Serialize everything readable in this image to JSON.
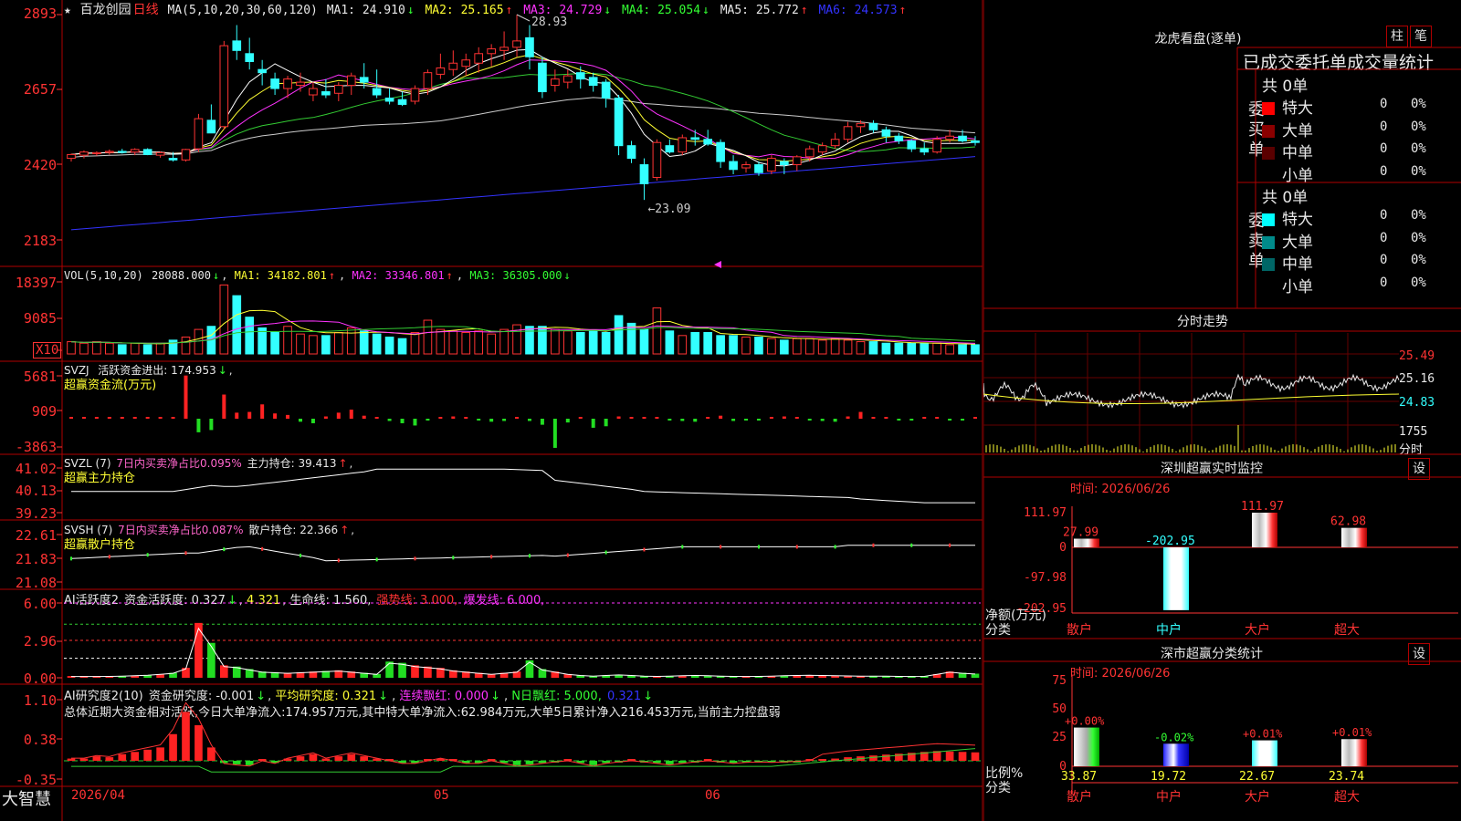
{
  "stock": {
    "star": "★",
    "name": "百龙创园",
    "period": "日线"
  },
  "ma": {
    "title": "MA(5,10,20,30,60,120)",
    "items": [
      {
        "label": "MA1: 24.910",
        "arrow": "↓",
        "color": "#e8e8e8"
      },
      {
        "label": "MA2: 25.165",
        "arrow": "↑",
        "color": "#ffff33"
      },
      {
        "label": "MA3: 24.729",
        "arrow": "↓",
        "color": "#ff33ff"
      },
      {
        "label": "MA4: 25.054",
        "arrow": "↓",
        "color": "#33ff33"
      },
      {
        "label": "MA5: 25.772",
        "arrow": "↑",
        "color": "#e8e8e8"
      },
      {
        "label": "MA6: 24.573",
        "arrow": "↑",
        "color": "#3333ff"
      }
    ],
    "high_note": "28.93",
    "low_note": "←23.09"
  },
  "price_axis": [
    "2893",
    "2657",
    "2420",
    "2183"
  ],
  "vol": {
    "title": "VOL(5,10,20)",
    "value": "28088.000",
    "items": [
      {
        "label": "MA1: 34182.801",
        "arrow": "↑",
        "color": "#ffff33"
      },
      {
        "label": "MA2: 33346.801",
        "arrow": "↑",
        "color": "#ff33ff"
      },
      {
        "label": "MA3: 36305.000",
        "arrow": "↓",
        "color": "#33ff33"
      }
    ],
    "axis": [
      "18397",
      "9085"
    ],
    "unit": "X10"
  },
  "svzj": {
    "name": "SVZJ",
    "label": "活跃资金进出: 174.953",
    "arrow": "↓",
    "sub": "超赢资金流(万元)",
    "axis": [
      "5681",
      "909",
      "-3863"
    ]
  },
  "svzl": {
    "name": "SVZL (7)",
    "note": "7日内买卖净占比0.095%",
    "label": "主力持仓: 39.413",
    "arrow": "↑",
    "sub": "超赢主力持仓",
    "axis": [
      "41.02",
      "40.13",
      "39.23"
    ]
  },
  "svsh": {
    "name": "SVSH (7)",
    "note": "7日内买卖净占比0.087%",
    "label": "散户持仓: 22.366",
    "arrow": "↑",
    "sub": "超赢散户持仓",
    "axis": [
      "22.61",
      "21.83",
      "21.08"
    ]
  },
  "ai1": {
    "name": "AI活跃度2",
    "label": "资金活跃度: 0.327",
    "arrow": "↓",
    "v2": "4.321",
    "life": "生命线: 1.560,",
    "strong": "强势线: 3.000,",
    "burst": "爆发线: 6.000,",
    "axis": [
      "6.00",
      "2.96",
      "0.00"
    ]
  },
  "ai2": {
    "name": "AI研究度2(10)",
    "label": "资金研究度: -0.001",
    "arrow": "↓",
    "avg": "平均研究度: 0.321",
    "avg_arrow": "↓",
    "red": "连续飘红: 0.000",
    "red_arrow": "↓",
    "nred": "N日飘红: 5.000,",
    "nval": "0.321",
    "nval_arrow": "↓",
    "summary": "总体近期大资金相对活跃,今日大单净流入:174.957万元,其中特大单净流入:62.984万元,大单5日累计净入216.453万元,当前主力控盘弱",
    "axis": [
      "1.10",
      "0.38",
      "-0.35"
    ]
  },
  "bottom": {
    "logo": "大智慧",
    "date": "2026/04",
    "m1": "05",
    "m2": "06"
  },
  "right": {
    "lhb_title": "龙虎看盘(逐单)",
    "btn_zhu": "柱",
    "btn_bi": "笔",
    "order_title": "已成交委托单成交量统计",
    "buy": {
      "side": "委买单",
      "total": "共 0单",
      "rows": [
        {
          "label": "特大",
          "count": "0",
          "pct": "0%",
          "color": "#ff0000"
        },
        {
          "label": "大单",
          "count": "0",
          "pct": "0%",
          "color": "#8b0000"
        },
        {
          "label": "中单",
          "count": "0",
          "pct": "0%",
          "color": "#5a0000"
        },
        {
          "label": "小单",
          "count": "0",
          "pct": "0%",
          "color": "#000000"
        }
      ]
    },
    "sell": {
      "side": "委卖单",
      "total": "共 0单",
      "rows": [
        {
          "label": "特大",
          "count": "0",
          "pct": "0%",
          "color": "#00ffff"
        },
        {
          "label": "大单",
          "count": "0",
          "pct": "0%",
          "color": "#008b8b"
        },
        {
          "label": "中单",
          "count": "0",
          "pct": "0%",
          "color": "#006666"
        },
        {
          "label": "小单",
          "count": "0",
          "pct": "0%",
          "color": "#000000"
        }
      ]
    },
    "intraday_title": "分时走势",
    "intraday_axis": [
      "25.49",
      "25.16",
      "24.83",
      "1755"
    ],
    "intraday_unit": "分时",
    "monitor_title": "深圳超赢实时监控",
    "monitor_date": "时间: 2026/06/26",
    "monitor_axis": [
      "111.97",
      "0",
      "-97.98",
      "-202.95"
    ],
    "monitor_ylabel": "净额(万元)",
    "monitor_xlabel": "分类",
    "monitor_bars": [
      {
        "cat": "散户",
        "value": "27.99",
        "color": "#ff3333"
      },
      {
        "cat": "中户",
        "value": "-202.95",
        "color": "#33ffff"
      },
      {
        "cat": "大户",
        "value": "111.97",
        "color": "#ff3333"
      },
      {
        "cat": "超大",
        "value": "62.98",
        "color": "#ff3333"
      }
    ],
    "class_title": "深市超赢分类统计",
    "class_date": "时间: 2026/06/26",
    "class_axis": [
      "75",
      "50",
      "25",
      "0"
    ],
    "class_ylabel": "比例%",
    "class_xlabel": "分类",
    "class_bars": [
      {
        "cat": "散户",
        "pct": "+0.00%",
        "value": "33.87"
      },
      {
        "cat": "中户",
        "pct": "-0.02%",
        "value": "19.72"
      },
      {
        "cat": "大户",
        "pct": "+0.01%",
        "value": "22.67"
      },
      {
        "cat": "超大",
        "pct": "+0.01%",
        "value": "23.74"
      }
    ],
    "set_label": "设"
  },
  "chart_data": {
    "type": "candlestick",
    "candles": [
      [
        24.4,
        24.55,
        24.3,
        24.52
      ],
      [
        24.5,
        24.65,
        24.4,
        24.6
      ],
      [
        24.55,
        24.62,
        24.48,
        24.58
      ],
      [
        24.6,
        24.68,
        24.52,
        24.62
      ],
      [
        24.62,
        24.7,
        24.55,
        24.6
      ],
      [
        24.6,
        24.72,
        24.5,
        24.68
      ],
      [
        24.68,
        24.72,
        24.5,
        24.52
      ],
      [
        24.5,
        24.62,
        24.42,
        24.58
      ],
      [
        24.4,
        24.6,
        24.3,
        24.35
      ],
      [
        24.35,
        24.7,
        24.3,
        24.68
      ],
      [
        24.7,
        25.8,
        24.6,
        25.65
      ],
      [
        25.6,
        26.1,
        25.2,
        25.2
      ],
      [
        25.4,
        28.1,
        25.3,
        27.95
      ],
      [
        28.1,
        28.6,
        27.5,
        27.8
      ],
      [
        27.7,
        28.2,
        27.2,
        27.45
      ],
      [
        27.2,
        27.5,
        26.7,
        27.1
      ],
      [
        26.9,
        27.1,
        26.4,
        26.6
      ],
      [
        26.6,
        27.0,
        26.3,
        26.9
      ],
      [
        26.7,
        27.1,
        26.5,
        26.8
      ],
      [
        26.4,
        26.8,
        26.2,
        26.6
      ],
      [
        26.5,
        26.9,
        26.3,
        26.4
      ],
      [
        26.45,
        26.8,
        26.2,
        26.7
      ],
      [
        26.7,
        27.1,
        26.4,
        27.0
      ],
      [
        26.95,
        27.4,
        26.6,
        26.8
      ],
      [
        26.6,
        27.2,
        26.3,
        26.4
      ],
      [
        26.3,
        26.6,
        26.1,
        26.2
      ],
      [
        26.25,
        26.5,
        26.05,
        26.1
      ],
      [
        26.2,
        26.7,
        26.1,
        26.6
      ],
      [
        26.6,
        27.2,
        26.4,
        27.1
      ],
      [
        27.05,
        27.7,
        26.9,
        27.25
      ],
      [
        27.2,
        27.8,
        27.0,
        27.4
      ],
      [
        27.3,
        27.7,
        27.0,
        27.5
      ],
      [
        27.4,
        27.9,
        27.1,
        27.7
      ],
      [
        27.7,
        28.0,
        27.3,
        27.85
      ],
      [
        27.8,
        28.4,
        27.5,
        27.9
      ],
      [
        27.9,
        28.93,
        27.6,
        28.1
      ],
      [
        28.2,
        28.6,
        27.2,
        27.6
      ],
      [
        27.4,
        27.6,
        26.3,
        26.5
      ],
      [
        26.7,
        27.2,
        26.5,
        26.9
      ],
      [
        26.8,
        27.2,
        26.6,
        27.0
      ],
      [
        27.1,
        27.3,
        26.6,
        26.9
      ],
      [
        26.95,
        27.1,
        26.5,
        26.7
      ],
      [
        26.8,
        26.9,
        26.0,
        26.3
      ],
      [
        26.3,
        26.4,
        24.5,
        24.8
      ],
      [
        24.8,
        24.95,
        24.25,
        24.4
      ],
      [
        24.2,
        24.4,
        23.09,
        23.6
      ],
      [
        23.8,
        25.0,
        23.7,
        24.9
      ],
      [
        24.8,
        25.0,
        24.55,
        24.6
      ],
      [
        24.6,
        25.15,
        24.5,
        25.05
      ],
      [
        25.05,
        25.3,
        24.8,
        25.0
      ],
      [
        25.0,
        25.3,
        24.8,
        24.85
      ],
      [
        24.9,
        25.0,
        24.1,
        24.3
      ],
      [
        24.3,
        24.5,
        23.9,
        24.05
      ],
      [
        24.1,
        24.3,
        23.95,
        24.2
      ],
      [
        24.2,
        24.3,
        23.85,
        23.95
      ],
      [
        24.0,
        24.5,
        23.9,
        24.4
      ],
      [
        24.3,
        24.4,
        23.9,
        24.2
      ],
      [
        24.2,
        24.5,
        24.0,
        24.45
      ],
      [
        24.45,
        24.8,
        24.3,
        24.7
      ],
      [
        24.6,
        24.9,
        24.5,
        24.8
      ],
      [
        24.8,
        25.2,
        24.7,
        25.0
      ],
      [
        25.0,
        25.55,
        24.9,
        25.4
      ],
      [
        25.4,
        25.6,
        25.2,
        25.5
      ],
      [
        25.5,
        25.6,
        25.2,
        25.3
      ],
      [
        25.3,
        25.4,
        24.9,
        25.1
      ],
      [
        25.1,
        25.2,
        24.85,
        24.95
      ],
      [
        24.95,
        25.0,
        24.6,
        24.7
      ],
      [
        24.7,
        24.9,
        24.5,
        24.6
      ],
      [
        24.6,
        25.1,
        24.55,
        25.0
      ],
      [
        25.0,
        25.3,
        24.9,
        25.1
      ],
      [
        25.1,
        25.3,
        24.9,
        24.95
      ],
      [
        24.95,
        25.1,
        24.8,
        24.9
      ]
    ],
    "volume": [
      8,
      7,
      8,
      7,
      6,
      7,
      6,
      7,
      9,
      11,
      16,
      18,
      45,
      38,
      24,
      17,
      14,
      18,
      13,
      12,
      12,
      14,
      17,
      15,
      13,
      11,
      10,
      14,
      22,
      16,
      15,
      14,
      15,
      13,
      16,
      19,
      18,
      18,
      16,
      15,
      14,
      15,
      14,
      25,
      20,
      16,
      30,
      15,
      12,
      14,
      14,
      12,
      12,
      11,
      11,
      10,
      9,
      10,
      10,
      9,
      10,
      9,
      8,
      8,
      7,
      7,
      7,
      7,
      7,
      6,
      6,
      6
    ],
    "svzj": [
      60,
      40,
      35,
      30,
      25,
      20,
      10,
      5,
      150,
      5721,
      -1800,
      -1500,
      3200,
      800,
      900,
      1900,
      700,
      500,
      -400,
      -600,
      300,
      800,
      1200,
      400,
      200,
      -300,
      -600,
      -900,
      -200,
      200,
      300,
      200,
      -200,
      -400,
      -300,
      100,
      -300,
      -800,
      -3863,
      -500,
      200,
      -1200,
      -1000,
      300,
      200,
      100,
      100,
      -200,
      -300,
      -400,
      200,
      400,
      -300,
      -200,
      -100,
      100,
      300,
      200,
      -200,
      -300,
      -400,
      300,
      900,
      200,
      100,
      -100,
      -100,
      100,
      200,
      -200,
      -100,
      100
    ],
    "ai1": [
      0.1,
      0.1,
      0.1,
      0.12,
      0.15,
      0.18,
      0.22,
      0.3,
      0.4,
      0.8,
      4.4,
      2.8,
      1.0,
      0.9,
      0.7,
      0.5,
      0.45,
      0.4,
      0.45,
      0.5,
      0.55,
      0.6,
      0.5,
      0.4,
      0.3,
      1.3,
      1.2,
      1.0,
      0.9,
      0.8,
      0.6,
      0.5,
      0.4,
      0.3,
      0.4,
      0.5,
      1.4,
      0.7,
      0.5,
      0.3,
      0.2,
      0.15,
      0.2,
      0.25,
      0.2,
      0.15,
      0.12,
      0.15,
      0.18,
      0.2,
      0.18,
      0.15,
      0.12,
      0.1,
      0.12,
      0.15,
      0.18,
      0.2,
      0.22,
      0.2,
      0.18,
      0.16,
      0.15,
      0.15,
      0.14,
      0.12,
      0.1,
      0.12,
      0.3,
      0.5,
      0.4,
      0.33
    ],
    "ai2": [
      0.05,
      0.05,
      0.1,
      0.08,
      0.15,
      0.2,
      0.25,
      0.3,
      0.6,
      1.1,
      0.8,
      0.3,
      -0.05,
      -0.08,
      -0.1,
      0.0,
      -0.05,
      0.05,
      0.1,
      0.15,
      0.05,
      0.1,
      0.15,
      0.1,
      0.05,
      0.0,
      -0.05,
      -0.05,
      0.0,
      0.05,
      0.0,
      -0.05,
      -0.05,
      0.0,
      -0.05,
      -0.1,
      -0.08,
      -0.05,
      -0.02,
      0.0,
      -0.05,
      -0.1,
      -0.05,
      -0.02,
      0.0,
      -0.02,
      -0.05,
      -0.08,
      -0.05,
      -0.02,
      0.0,
      -0.02,
      -0.05,
      -0.03,
      -0.02,
      -0.03,
      -0.02,
      -0.01,
      0.0,
      0.02,
      0.05,
      0.08,
      0.1,
      0.12,
      0.14,
      0.16,
      0.18,
      0.2,
      0.22,
      0.21,
      0.2,
      0.19
    ]
  }
}
